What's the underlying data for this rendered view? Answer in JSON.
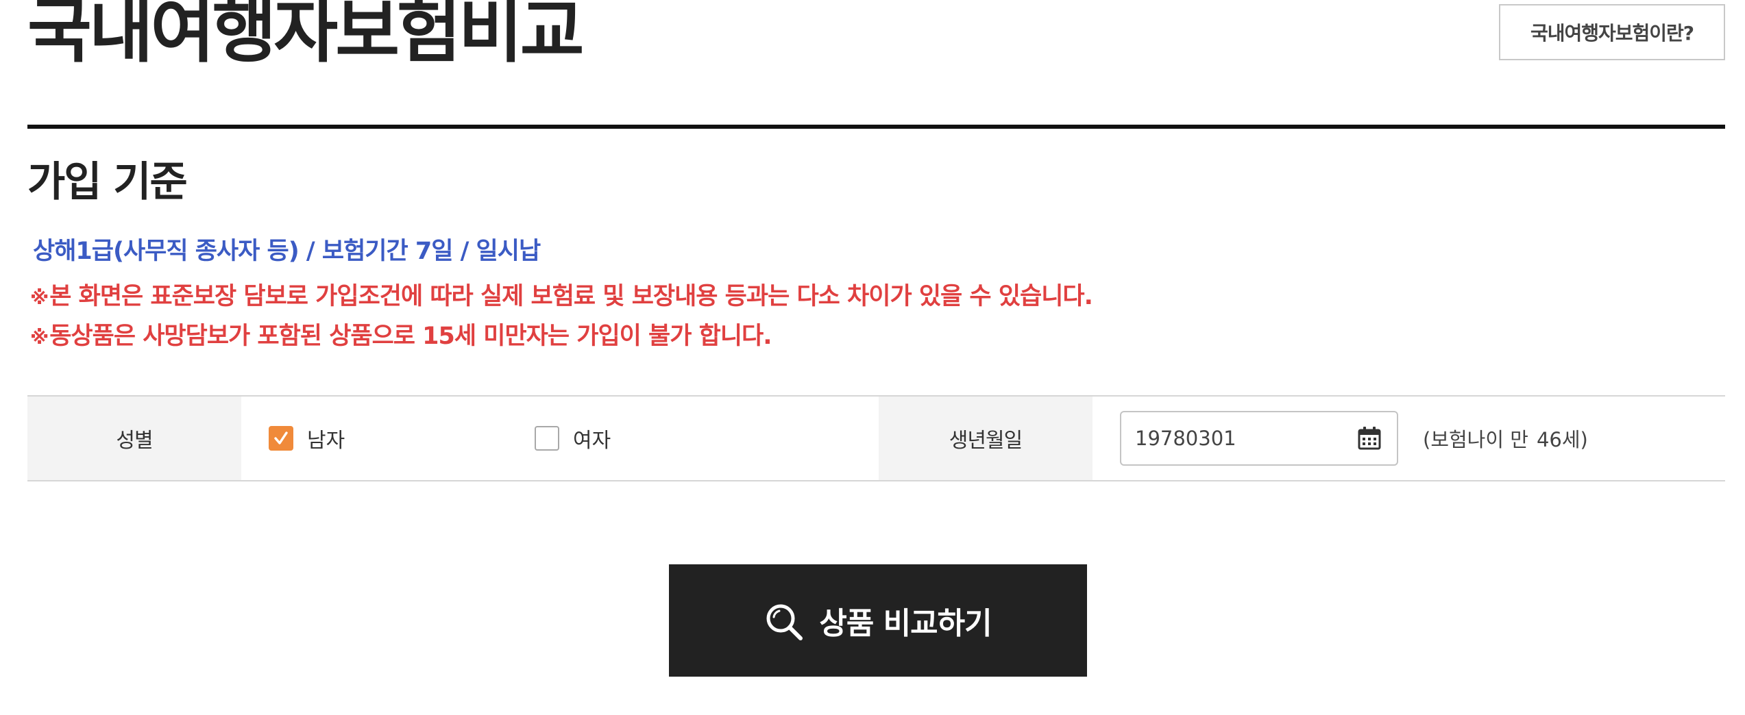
{
  "header": {
    "title": "국내여행자보험비교",
    "info_button": "국내여행자보험이란?"
  },
  "section": {
    "title": "가입 기준",
    "criteria": "상해1급(사무직 종사자 등) / 보험기간 7일 / 일시납",
    "notice_mark": "※",
    "notices": [
      "본 화면은 표준보장 담보로 가입조건에 따라 실제 보험료 및 보장내용 등과는 다소 차이가 있을 수 있습니다.",
      "동상품은 사망담보가 포함된 상품으로 15세 미만자는 가입이 불가 합니다."
    ]
  },
  "form": {
    "gender": {
      "label": "성별",
      "options": [
        {
          "label": "남자",
          "checked": true
        },
        {
          "label": "여자",
          "checked": false
        }
      ]
    },
    "birth": {
      "label": "생년월일",
      "value": "19780301",
      "age_prefix": "(보험나이 만",
      "age_value": "46세)"
    }
  },
  "actions": {
    "compare_label": "상품 비교하기"
  },
  "colors": {
    "accent_orange": "#f08a3a",
    "criteria_blue": "#3b5bc4",
    "notice_red": "#e04040",
    "button_dark": "#222222"
  }
}
